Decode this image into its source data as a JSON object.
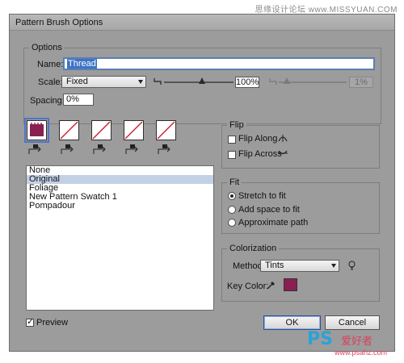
{
  "watermark_top": "思缘设计论坛 www.MISSYUAN.COM",
  "dialog": {
    "title": "Pattern Brush Options"
  },
  "options": {
    "group_label": "Options",
    "name_label": "Name:",
    "name_value": "Thread",
    "scale_label": "Scale:",
    "scale_method": "Fixed",
    "scale_min_pct": "100%",
    "scale_min_fraction": 0.55,
    "scale_max_pct": "1%",
    "scale_max_fraction": 0.0,
    "spacing_label": "Spacing:",
    "spacing_value": "0%"
  },
  "tiles": [
    {
      "name": "side-tile",
      "swatch": true,
      "selected": true
    },
    {
      "name": "outer-corner-tile",
      "swatch": false,
      "selected": false
    },
    {
      "name": "inner-corner-tile",
      "swatch": false,
      "selected": false
    },
    {
      "name": "start-tile",
      "swatch": false,
      "selected": false
    },
    {
      "name": "end-tile",
      "swatch": false,
      "selected": false
    }
  ],
  "pattern_list": [
    "None",
    "Original",
    "Foliage",
    "New Pattern Swatch 1",
    "Pompadour"
  ],
  "pattern_selected_index": 1,
  "flip": {
    "group_label": "Flip",
    "along_label": "Flip Along",
    "along_checked": false,
    "across_label": "Flip Across",
    "across_checked": false
  },
  "fit": {
    "group_label": "Fit",
    "options": [
      "Stretch to fit",
      "Add space to fit",
      "Approximate path"
    ],
    "selected_index": 0
  },
  "colorization": {
    "group_label": "Colorization",
    "method_label": "Method:",
    "method_value": "Tints",
    "key_color_label": "Key Color:",
    "key_color_hex": "#8a1f52"
  },
  "preview": {
    "label": "Preview",
    "checked": true
  },
  "buttons": {
    "ok": "OK",
    "cancel": "Cancel"
  },
  "logo": {
    "ps": "PS",
    "cn": "爱好者",
    "url": "www.psahz.com"
  },
  "colors": {
    "dialog_bg": "#9c9c9c",
    "selection_blue": "#3d74c7",
    "swatch_magenta": "#8a1f52",
    "tile_slash": "#c8202a"
  }
}
